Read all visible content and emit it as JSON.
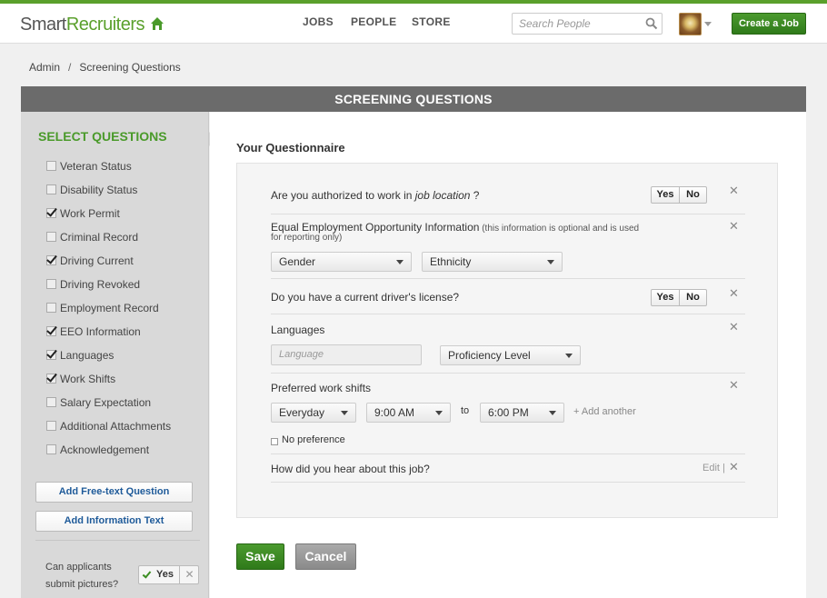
{
  "header": {
    "logo_part1": "Smart",
    "logo_part2": "Recruiters",
    "nav": [
      "JOBS",
      "PEOPLE",
      "STORE"
    ],
    "search_placeholder": "Search People",
    "create_job": "Create a Job"
  },
  "breadcrumb": {
    "root": "Admin",
    "separator": "/",
    "current": "Screening Questions"
  },
  "panel_title": "SCREENING QUESTIONS",
  "sidebar": {
    "title": "SELECT QUESTIONS",
    "items": [
      {
        "label": "Veteran Status",
        "checked": false
      },
      {
        "label": "Disability Status",
        "checked": false
      },
      {
        "label": "Work Permit",
        "checked": true
      },
      {
        "label": "Criminal Record",
        "checked": false
      },
      {
        "label": "Driving Current",
        "checked": true
      },
      {
        "label": "Driving Revoked",
        "checked": false
      },
      {
        "label": "Employment Record",
        "checked": false
      },
      {
        "label": "EEO Information",
        "checked": true
      },
      {
        "label": "Languages",
        "checked": true
      },
      {
        "label": "Work Shifts",
        "checked": true
      },
      {
        "label": "Salary Expectation",
        "checked": false
      },
      {
        "label": "Additional Attachments",
        "checked": false
      },
      {
        "label": "Acknowledgement",
        "checked": false
      }
    ],
    "add_free_text": "Add Free-text Question",
    "add_info_text": "Add Information Text",
    "pictures_label": "Can applicants submit pictures?",
    "pictures_yes": "Yes",
    "pictures_no": "✕"
  },
  "main": {
    "title": "Your Questionnaire",
    "q1": {
      "prefix": "Are you authorized to work in ",
      "italic": "job location",
      "suffix": " ?",
      "yes": "Yes",
      "no": "No"
    },
    "q2": {
      "text": "Equal Employment Opportunity Information",
      "note": " (this information is optional and is used",
      "note2": "for reporting only)",
      "select1": "Gender",
      "select2": "Ethnicity"
    },
    "q3": {
      "text": "Do you have a current driver's license?",
      "yes": "Yes",
      "no": "No"
    },
    "q4": {
      "text": "Languages",
      "language_placeholder": "Language",
      "proficiency": "Proficiency Level"
    },
    "q5": {
      "text": "Preferred work shifts",
      "days": "Everyday",
      "from": "9:00 AM",
      "to_label": "to",
      "to": "6:00 PM",
      "add_another": "+ Add another",
      "no_preference": "No preference"
    },
    "q6": {
      "text": "How did you hear about this job?",
      "edit": "Edit |"
    },
    "close_glyph": "✕",
    "save": "Save",
    "cancel": "Cancel"
  },
  "colors": {
    "brand_green": "#5aa02c",
    "title_bar": "#6b6b6b",
    "link_blue": "#1e5a99"
  }
}
